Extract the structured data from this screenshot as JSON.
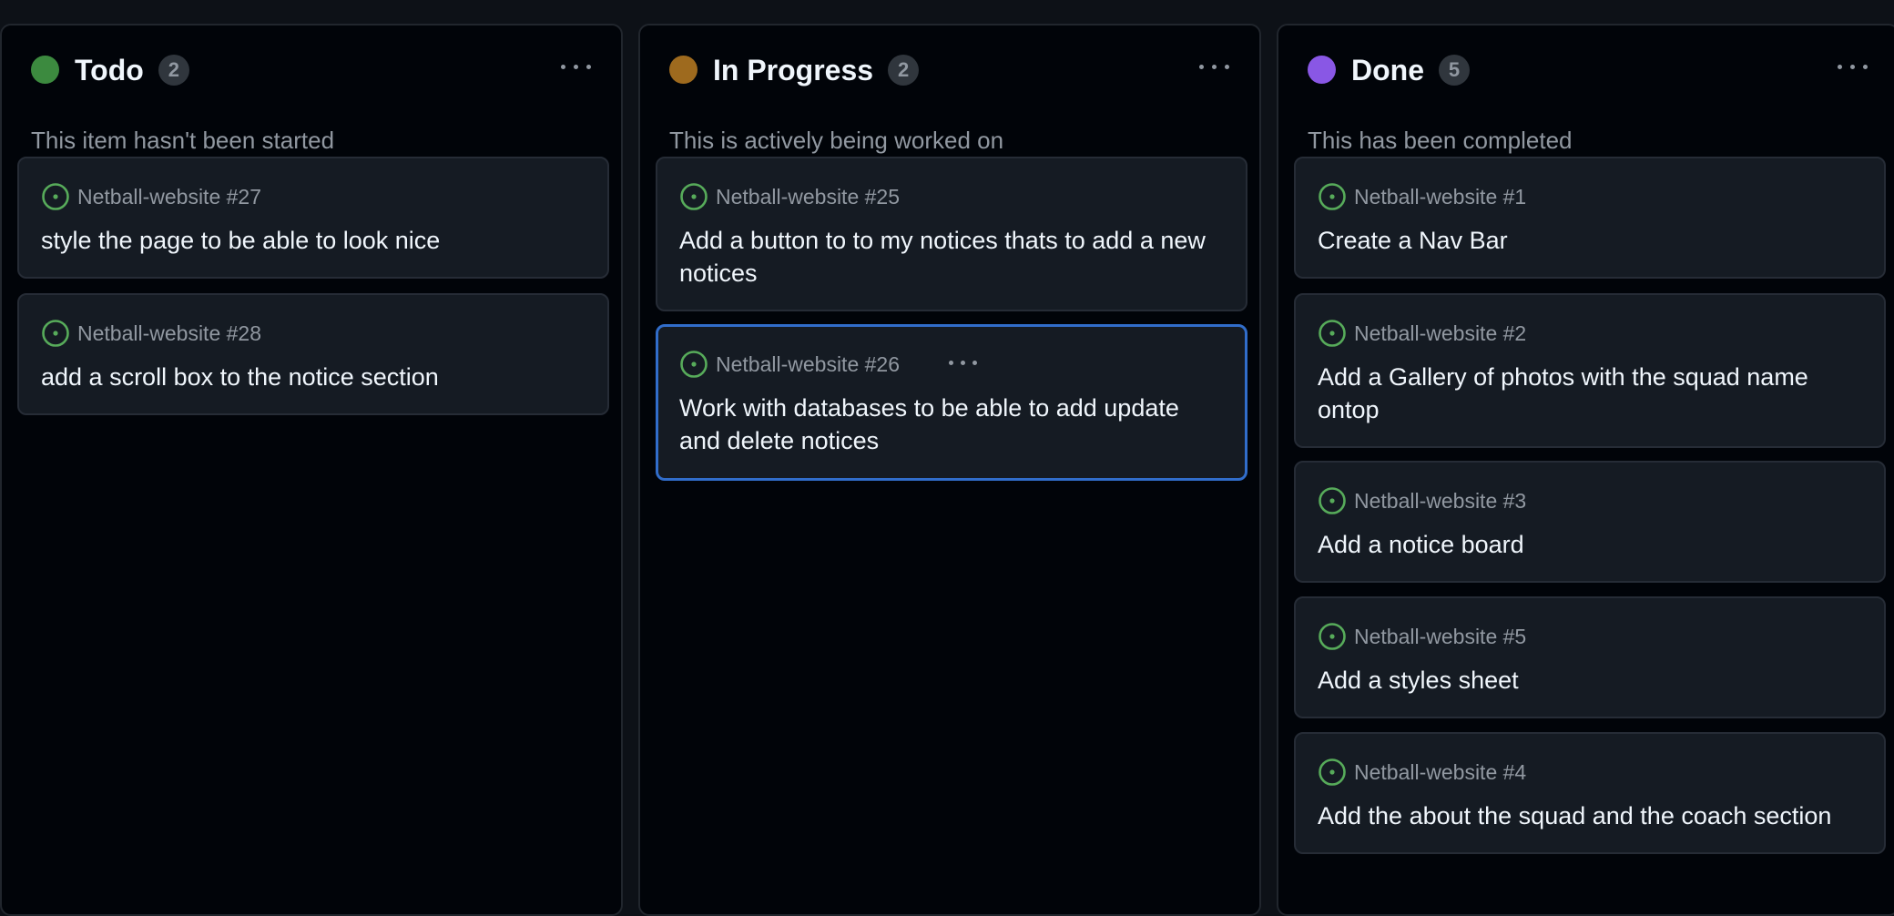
{
  "columns": [
    {
      "name": "Todo",
      "count": "2",
      "description": "This item hasn't been started",
      "dot_color": "#3c8a3f",
      "cards": [
        {
          "repo": "Netball-website #27",
          "title": "style the page to be able to look nice"
        },
        {
          "repo": "Netball-website #28",
          "title": "add a scroll box to the notice section"
        }
      ]
    },
    {
      "name": "In Progress",
      "count": "2",
      "description": "This is actively being worked on",
      "dot_color": "#9e6a1e",
      "cards": [
        {
          "repo": "Netball-website #25",
          "title": "Add a button to to my notices thats to add a new notices"
        },
        {
          "repo": "Netball-website #26",
          "title": "Work with databases to be able to add update and delete notices",
          "selected": true
        }
      ]
    },
    {
      "name": "Done",
      "count": "5",
      "description": "This has been completed",
      "dot_color": "#8957e5",
      "cards": [
        {
          "repo": "Netball-website #1",
          "title": "Create a Nav Bar"
        },
        {
          "repo": "Netball-website #2",
          "title": "Add a Gallery of photos with the squad name ontop"
        },
        {
          "repo": "Netball-website #3",
          "title": "Add a notice board"
        },
        {
          "repo": "Netball-website #5",
          "title": "Add a styles sheet"
        },
        {
          "repo": "Netball-website #4",
          "title": "Add the about the squad and the coach section"
        }
      ]
    }
  ],
  "icons": {
    "open_issue": "issue-opened-icon",
    "more": "kebab-horizontal-icon"
  },
  "colors": {
    "issue_open": "#57ab5a",
    "selection_border": "#316dca"
  }
}
